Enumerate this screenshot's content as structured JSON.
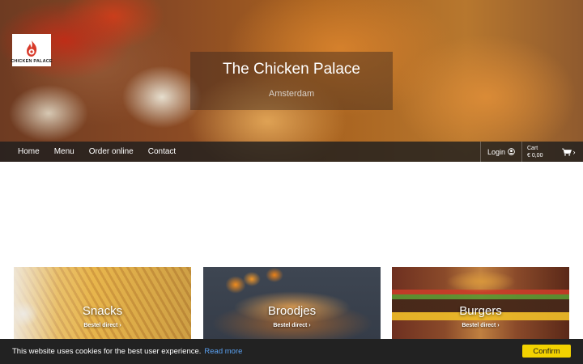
{
  "brand": {
    "logo_text": "CHICKEN PALACE",
    "title": "The Chicken Palace",
    "location": "Amsterdam"
  },
  "nav": {
    "links": [
      {
        "label": "Home"
      },
      {
        "label": "Menu"
      },
      {
        "label": "Order online"
      },
      {
        "label": "Contact"
      }
    ],
    "login_label": "Login",
    "cart_label": "Cart",
    "cart_amount": "€ 0,00",
    "cart_chevron": "›"
  },
  "categories": [
    {
      "title": "Snacks",
      "cta": "Bestel direct ›"
    },
    {
      "title": "Broodjes",
      "cta": "Bestel direct ›"
    },
    {
      "title": "Burgers",
      "cta": "Bestel direct ›"
    }
  ],
  "cookie_bar": {
    "message": "This website uses cookies for the best user experience.",
    "link": "Read more",
    "button": "Confirm"
  },
  "colors": {
    "nav_bg": "#1e1e1e",
    "cookie_bg": "#222222",
    "cookie_link": "#5aa0f0",
    "confirm_button": "#f2d200",
    "logo_accent": "#d83a2a"
  },
  "icons": {
    "user": "user-circle-icon",
    "cart": "shopping-cart-icon",
    "logo": "chicken-flame-icon"
  }
}
